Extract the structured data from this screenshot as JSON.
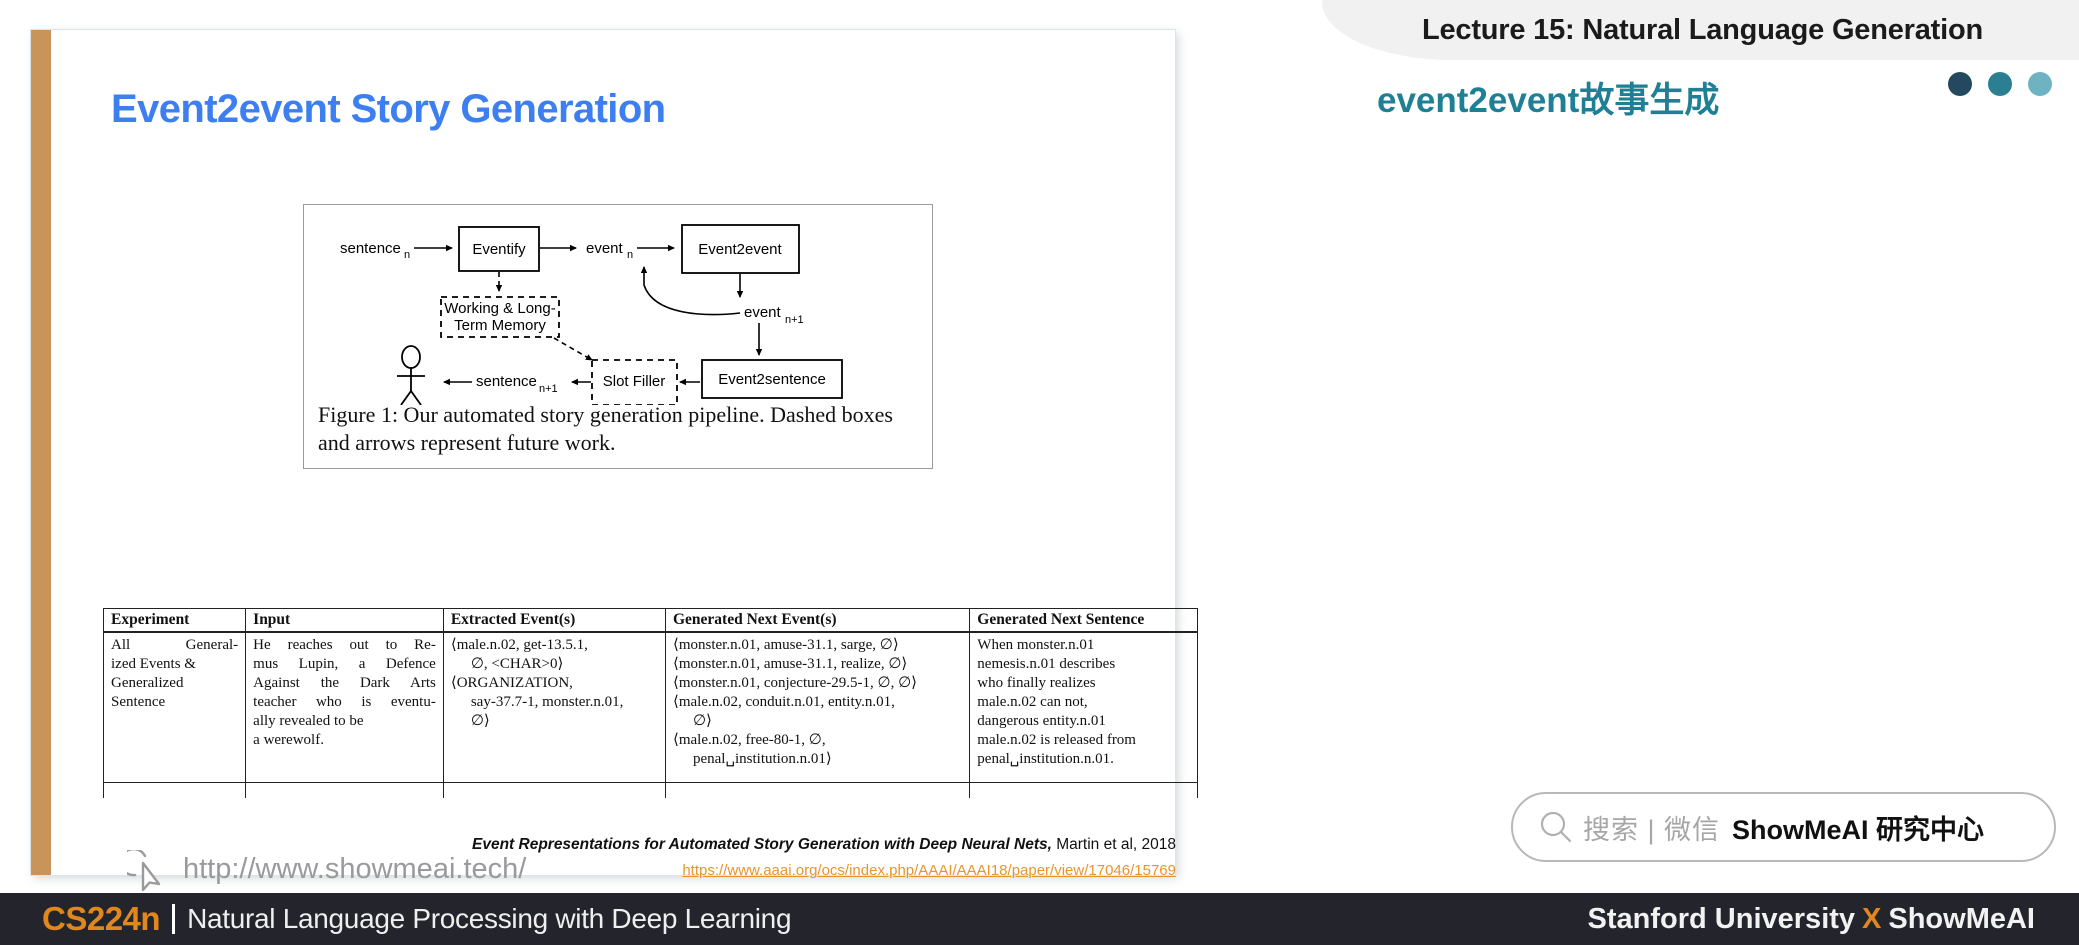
{
  "header": {
    "lecture_title": "Lecture 15: Natural Language Generation",
    "brand_title": "event2event故事生成",
    "dots": [
      "#24485e",
      "#2b7f93",
      "#6fb3c2"
    ],
    "logo_colors": {
      "dot": "#24485e",
      "quarter": "#64aebd",
      "hill": "#207a8e"
    },
    "brand_color": "#1f7f95"
  },
  "slide": {
    "title": "Event2event Story Generation",
    "title_color": "#3d7ff0",
    "accent_bar_color": "#c8945a",
    "figure": {
      "caption": "Figure 1: Our automated story generation pipeline. Dashed boxes and arrows represent future work.",
      "nodes": [
        {
          "id": "sentence-n",
          "label": "sentence",
          "sub": "n",
          "type": "label"
        },
        {
          "id": "eventify",
          "label": "Eventify",
          "type": "box-solid"
        },
        {
          "id": "event-n",
          "label": "event",
          "sub": "n",
          "type": "label"
        },
        {
          "id": "event2event",
          "label": "Event2event",
          "type": "box-solid"
        },
        {
          "id": "working-memory",
          "label": "Working & Long-",
          "label2": "Term Memory",
          "type": "box-dashed"
        },
        {
          "id": "event-n1",
          "label": "event",
          "sub": "n+1",
          "type": "label"
        },
        {
          "id": "event2sentence",
          "label": "Event2sentence",
          "type": "box-solid"
        },
        {
          "id": "slot-filler",
          "label": "Slot Filler",
          "type": "box-dashed"
        },
        {
          "id": "sentence-n1",
          "label": "sentence",
          "sub": "n+1",
          "type": "label"
        },
        {
          "id": "reader",
          "label": "",
          "type": "stick-figure"
        }
      ]
    },
    "table": {
      "headers": [
        "Experiment",
        "Input",
        "Extracted Event(s)",
        "Generated Next Event(s)",
        "Generated Next Sentence"
      ],
      "rows": [
        {
          "experiment": "All General-ized Events & Generalized Sentence",
          "experiment_lines": [
            "All   General-",
            "ized Events &",
            "Generalized",
            "Sentence"
          ],
          "input_lines": [
            "He reaches out to Re-",
            "mus Lupin, a Defence",
            "Against the Dark Arts",
            "teacher who is eventu-",
            "ally revealed to be",
            "a werewolf."
          ],
          "extracted_lines": [
            "⟨male.n.02, get-13.5.1,",
            "∅, <CHAR>0⟩",
            "⟨ORGANIZATION,",
            "say-37.7-1, monster.n.01,",
            "∅⟩"
          ],
          "generated_events_lines": [
            "⟨monster.n.01, amuse-31.1, sarge, ∅⟩",
            "⟨monster.n.01, amuse-31.1, realize, ∅⟩",
            "⟨monster.n.01, conjecture-29.5-1, ∅, ∅⟩",
            "⟨male.n.02,  conduit.n.01,  entity.n.01,",
            "∅⟩",
            "⟨male.n.02, free-80-1, ∅,",
            "penal␣institution.n.01⟩"
          ],
          "generated_sentence_lines": [
            "When         monster.n.01",
            "nemesis.n.01     describes",
            "who     finally     realizes",
            "male.n.02      can      not,",
            "dangerous       entity.n.01",
            "male.n.02 is released from",
            "penal␣institution.n.01."
          ]
        }
      ]
    },
    "citation": {
      "text": "Event Representations for Automated Story Generation with Deep Neural Nets,",
      "authors": " Martin et al, 2018",
      "link": "https://www.aaai.org/ocs/index.php/AAAI/AAAI18/paper/view/17046/15769",
      "link_color": "#e8952c"
    },
    "showmeai_url": "http://www.showmeai.tech/"
  },
  "search": {
    "placeholder": "搜索 | 微信",
    "brand": "ShowMeAI 研究中心"
  },
  "footer": {
    "course_code": "CS224n",
    "course_title": "Natural Language Processing with Deep Learning",
    "right_left": "Stanford University",
    "right_x": "X",
    "right_right": "ShowMeAI",
    "accent": "#e08820",
    "bg": "#23242c"
  }
}
